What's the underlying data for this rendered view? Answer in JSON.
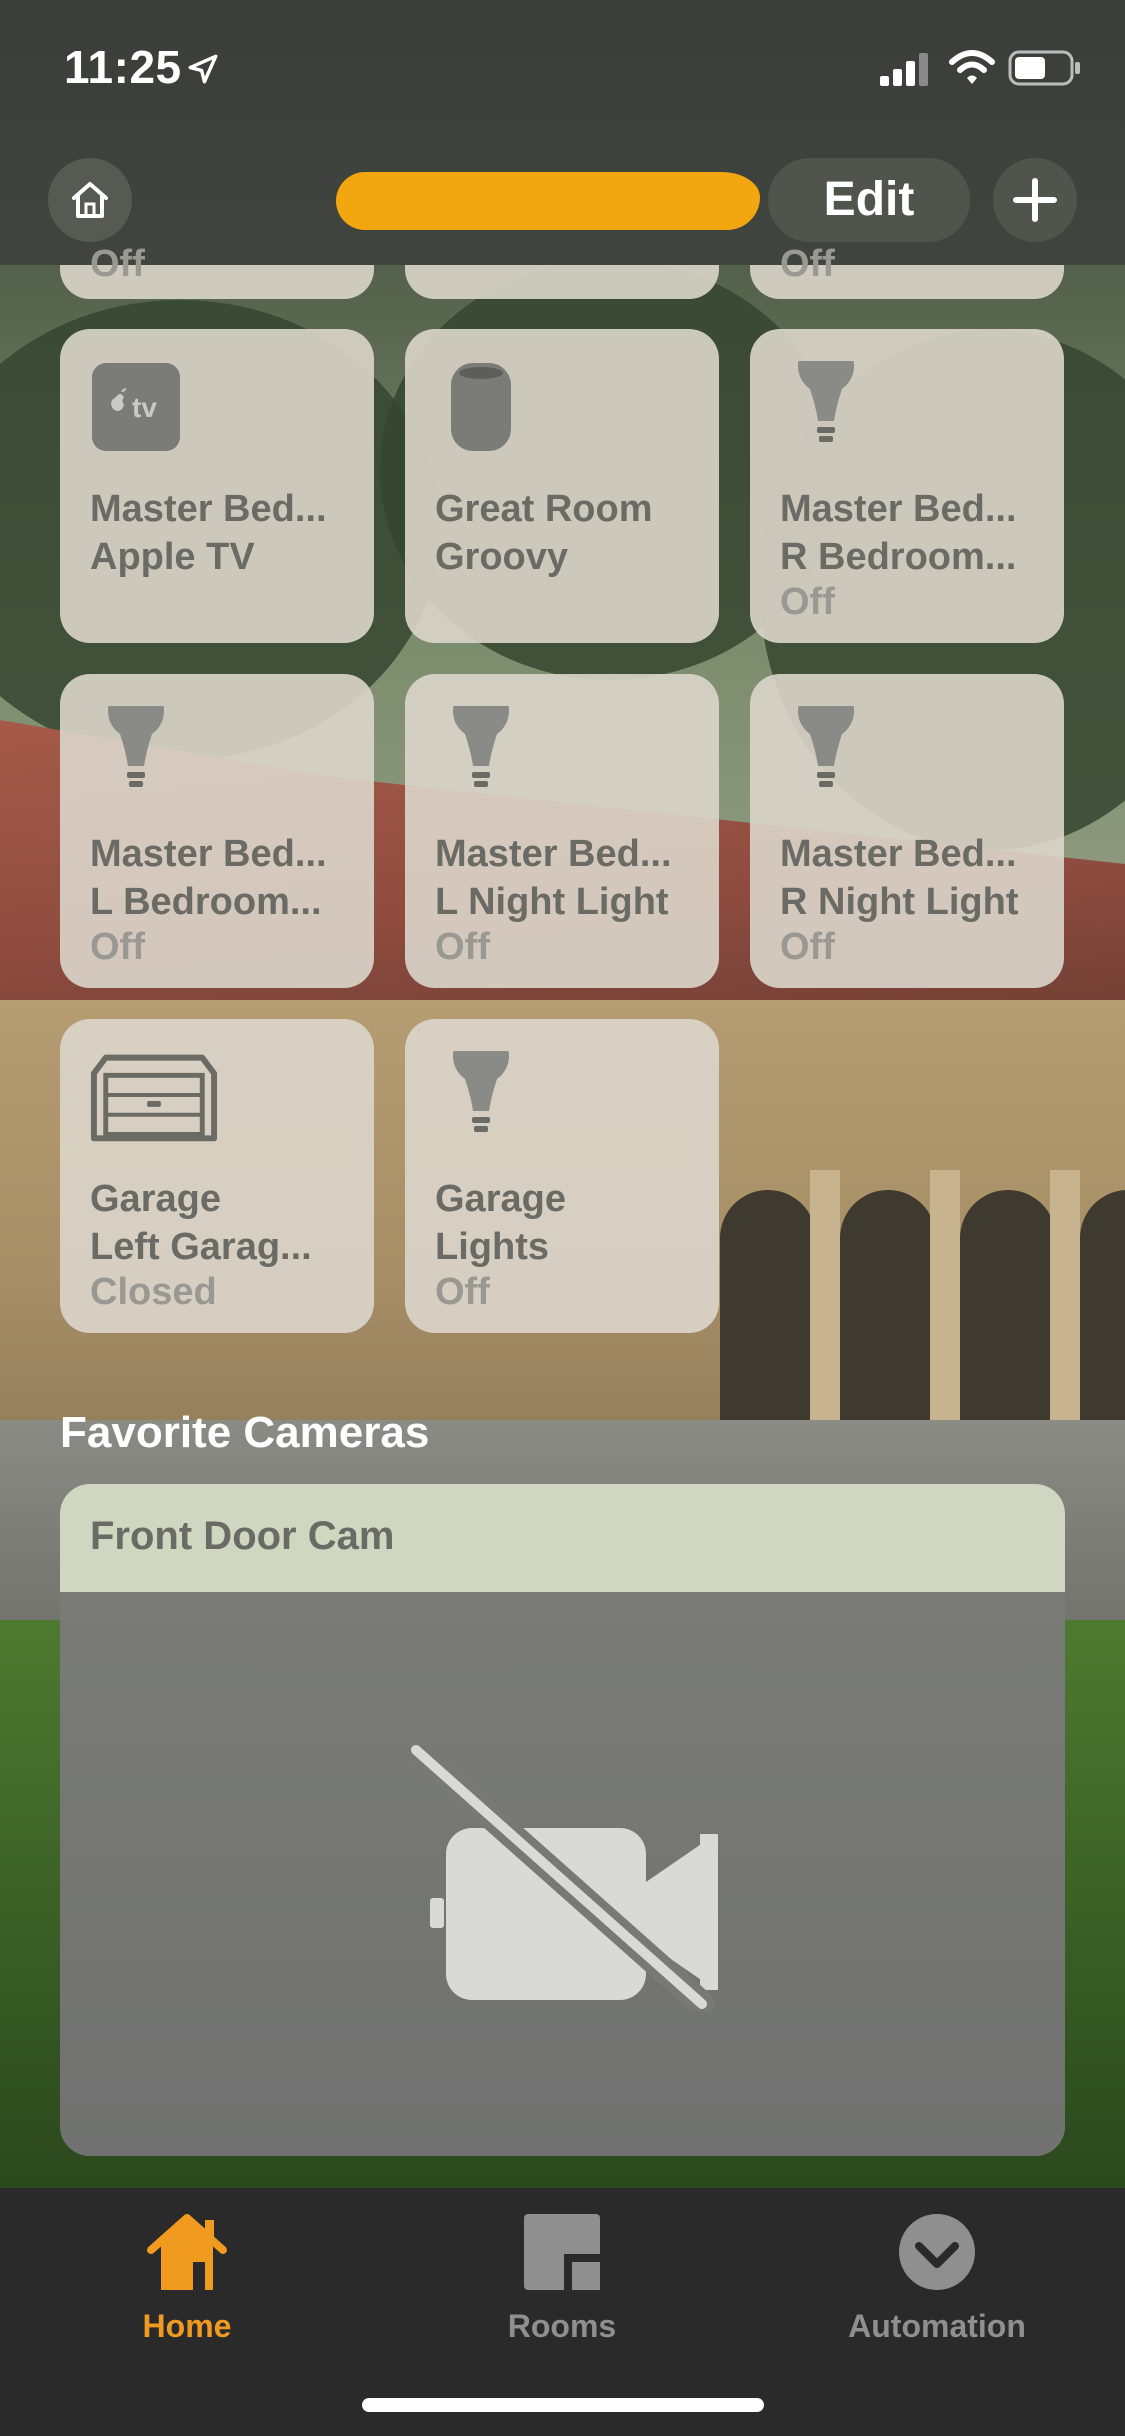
{
  "status_bar": {
    "time": "11:25",
    "icons": [
      "location-arrow-icon",
      "cellular-signal-icon",
      "wifi-icon",
      "battery-icon"
    ]
  },
  "header": {
    "home_name": "",
    "edit_label": "Edit",
    "icons": [
      "home-icon",
      "plus-icon"
    ]
  },
  "partial_tiles": [
    {
      "status": "Off"
    },
    {
      "status": ""
    },
    {
      "status": "Off"
    }
  ],
  "tiles": [
    {
      "room": "Master Bed...",
      "name": "Apple TV",
      "status": "",
      "icon": "apple-tv-icon"
    },
    {
      "room": "Great Room",
      "name": "Groovy",
      "status": "",
      "icon": "homepod-icon"
    },
    {
      "room": "Master Bed...",
      "name": "R Bedroom...",
      "status": "Off",
      "icon": "light-bulb-icon"
    },
    {
      "room": "Master Bed...",
      "name": "L Bedroom...",
      "status": "Off",
      "icon": "light-bulb-icon"
    },
    {
      "room": "Master Bed...",
      "name": "L Night Light",
      "status": "Off",
      "icon": "light-bulb-icon"
    },
    {
      "room": "Master Bed...",
      "name": "R Night Light",
      "status": "Off",
      "icon": "light-bulb-icon"
    },
    {
      "room": "Garage",
      "name": "Left Garag...",
      "status": "Closed",
      "icon": "garage-door-icon"
    },
    {
      "room": "Garage",
      "name": "Lights",
      "status": "Off",
      "icon": "light-bulb-icon"
    }
  ],
  "favorite_cameras": {
    "title": "Favorite Cameras",
    "cameras": [
      {
        "name": "Front Door Cam",
        "icon": "video-off-icon"
      }
    ]
  },
  "tab_bar": {
    "tabs": [
      {
        "label": "Home",
        "icon": "home-tab-icon",
        "active": true
      },
      {
        "label": "Rooms",
        "icon": "rooms-tab-icon",
        "active": false
      },
      {
        "label": "Automation",
        "icon": "automation-tab-icon",
        "active": false
      }
    ]
  },
  "colors": {
    "accent": "#f09a1f",
    "redaction": "#f2a60f",
    "tile": "#dbd6cb",
    "tab_bar": "#2a2a2a"
  }
}
